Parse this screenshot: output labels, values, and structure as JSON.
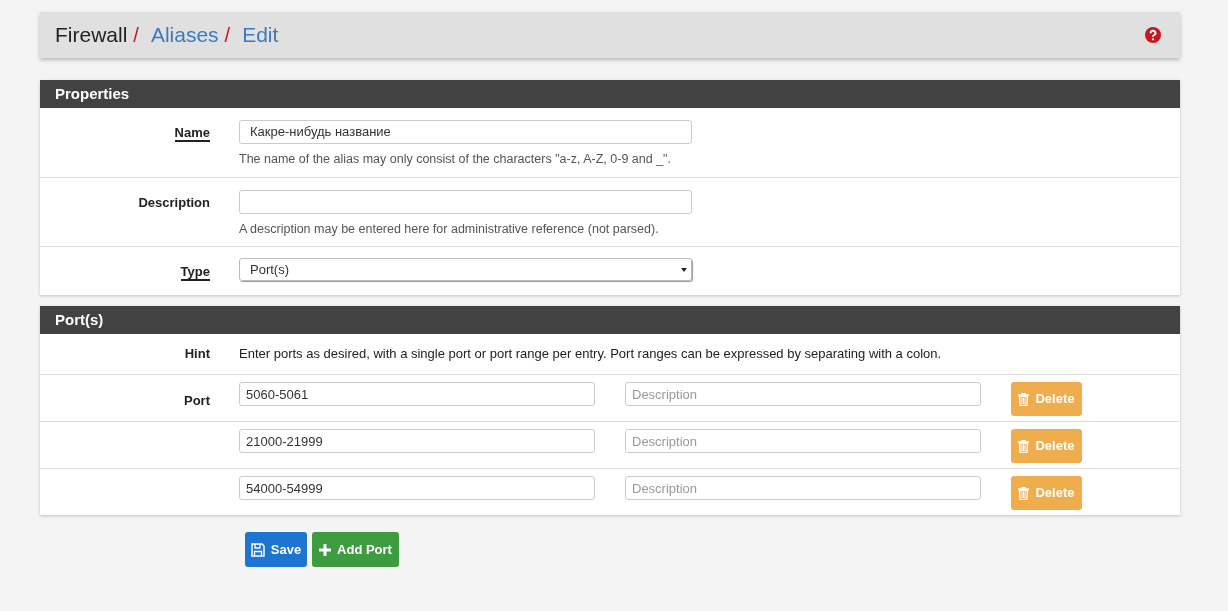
{
  "breadcrumb": [
    {
      "text": "Firewall",
      "link": false
    },
    {
      "text": "/",
      "kind": "separator"
    },
    {
      "text": "Aliases",
      "link": true
    },
    {
      "text": "/",
      "kind": "separator"
    },
    {
      "text": "Edit",
      "link": true
    }
  ],
  "properties": {
    "title": "Properties",
    "fields": [
      {
        "kind": "text",
        "label": "Name",
        "required": true,
        "value": "Какре-нибудь название",
        "help": "The name of the alias may only consist of the characters \"a-z, A-Z, 0-9 and _\"."
      },
      {
        "kind": "text",
        "label": "Description",
        "required": false,
        "help": "A description may be entered here for administrative reference (not parsed)."
      },
      {
        "kind": "select",
        "label": "Type",
        "required": true,
        "value": "Port(s)"
      }
    ]
  },
  "ports": {
    "title": "Port(s)",
    "hint_label": "Hint",
    "hint": "Enter ports as desired, with a single port or port range per entry. Port ranges can be expressed by separating with a colon.",
    "port_label": "Port",
    "rows": [
      {
        "value": "5060-5061",
        "description_placeholder": "Description",
        "delete": "Delete"
      },
      {
        "value": "21000-21999",
        "description_placeholder": "Description",
        "delete": "Delete"
      },
      {
        "value": "54000-54999",
        "description_placeholder": "Description",
        "delete": "Delete"
      }
    ]
  },
  "buttons": [
    {
      "kind": "save",
      "label": "Save"
    },
    {
      "kind": "add",
      "label": "Add Port"
    }
  ]
}
